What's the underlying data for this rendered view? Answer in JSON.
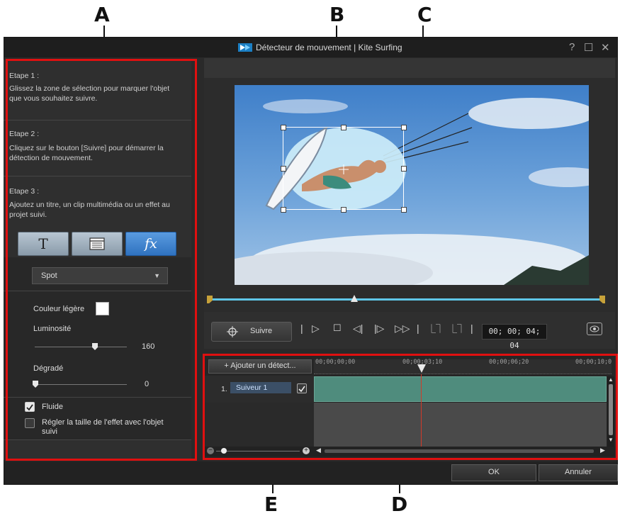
{
  "callouts": {
    "a": "A",
    "b": "B",
    "c": "C",
    "d": "D",
    "e": "E"
  },
  "window": {
    "title": "Détecteur de mouvement  |  Kite Surfing",
    "help": "?",
    "maximize": "☐",
    "close": "✕"
  },
  "steps": [
    {
      "heading": "Etape 1 :",
      "text": "Glissez la zone de sélection pour marquer l'objet que vous souhaitez suivre."
    },
    {
      "heading": "Etape 2 :",
      "text": "Cliquez sur le bouton [Suivre] pour démarrer la détection de mouvement."
    },
    {
      "heading": "Etape 3 :",
      "text": "Ajoutez un titre, un clip multimédia ou un effet au projet suivi."
    }
  ],
  "tools": {
    "title": "T",
    "fx": "fx"
  },
  "effect": {
    "selected": "Spot",
    "color_label": "Couleur légère",
    "luminosity_label": "Luminosité",
    "luminosity_value": "160",
    "luminosity_level": 0.5,
    "gradient_label": "Dégradé",
    "gradient_value": "0",
    "gradient_level": 0.0,
    "fluid_label": "Fluide",
    "fluid_checked": true,
    "resize_label": "Régler la taille de l'effet avec l'objet suivi",
    "resize_checked": false
  },
  "player": {
    "track_label": "Suivre",
    "timecode": "00; 00; 04; 04"
  },
  "timeline": {
    "add_button": "+ Ajouter un détect...",
    "ticks": [
      "00;00;00;00",
      "00;00;03;10",
      "00;00;06;20",
      "00;00;10;0"
    ],
    "tracker_index": "1.",
    "tracker_name": "Suiveur 1",
    "tracker_checked": true
  },
  "footer": {
    "ok": "OK",
    "cancel": "Annuler"
  },
  "colors": {
    "accent": "#2f72c0",
    "highlight": "#e01010",
    "clip": "#4f8c7d"
  }
}
